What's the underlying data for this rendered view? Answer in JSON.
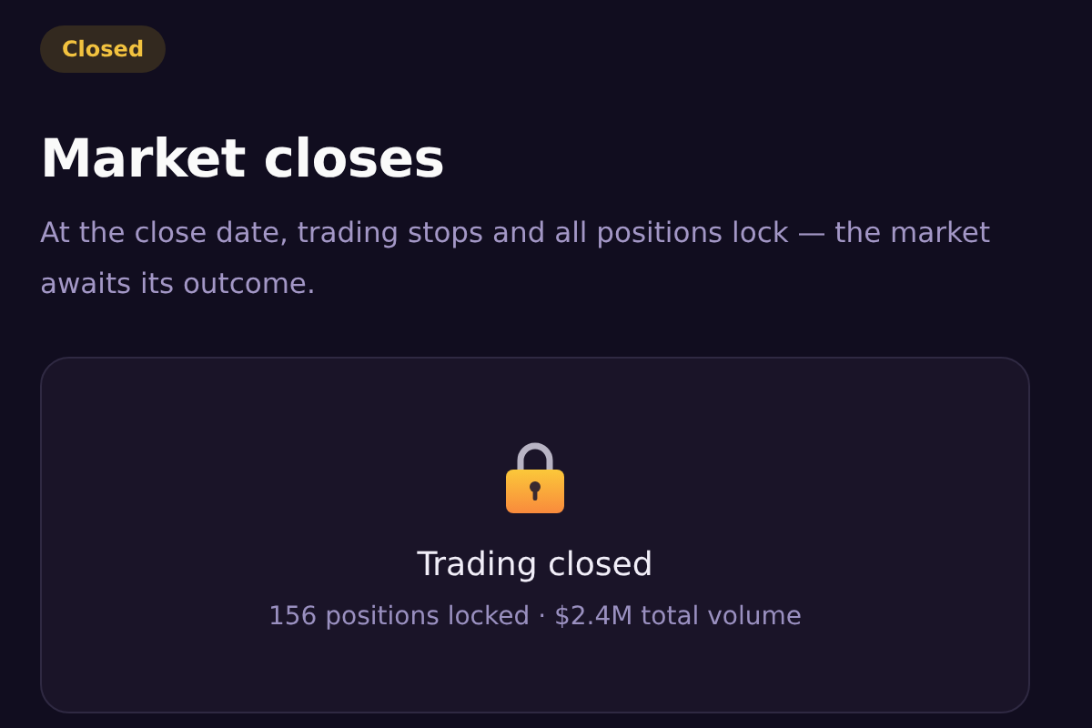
{
  "badge": {
    "label": "Closed"
  },
  "title": "Market closes",
  "description": "At the close date, trading stops and all positions lock — the market awaits its outcome.",
  "card": {
    "heading": "Trading closed",
    "summary": "156 positions locked · $2.4M total volume"
  }
}
